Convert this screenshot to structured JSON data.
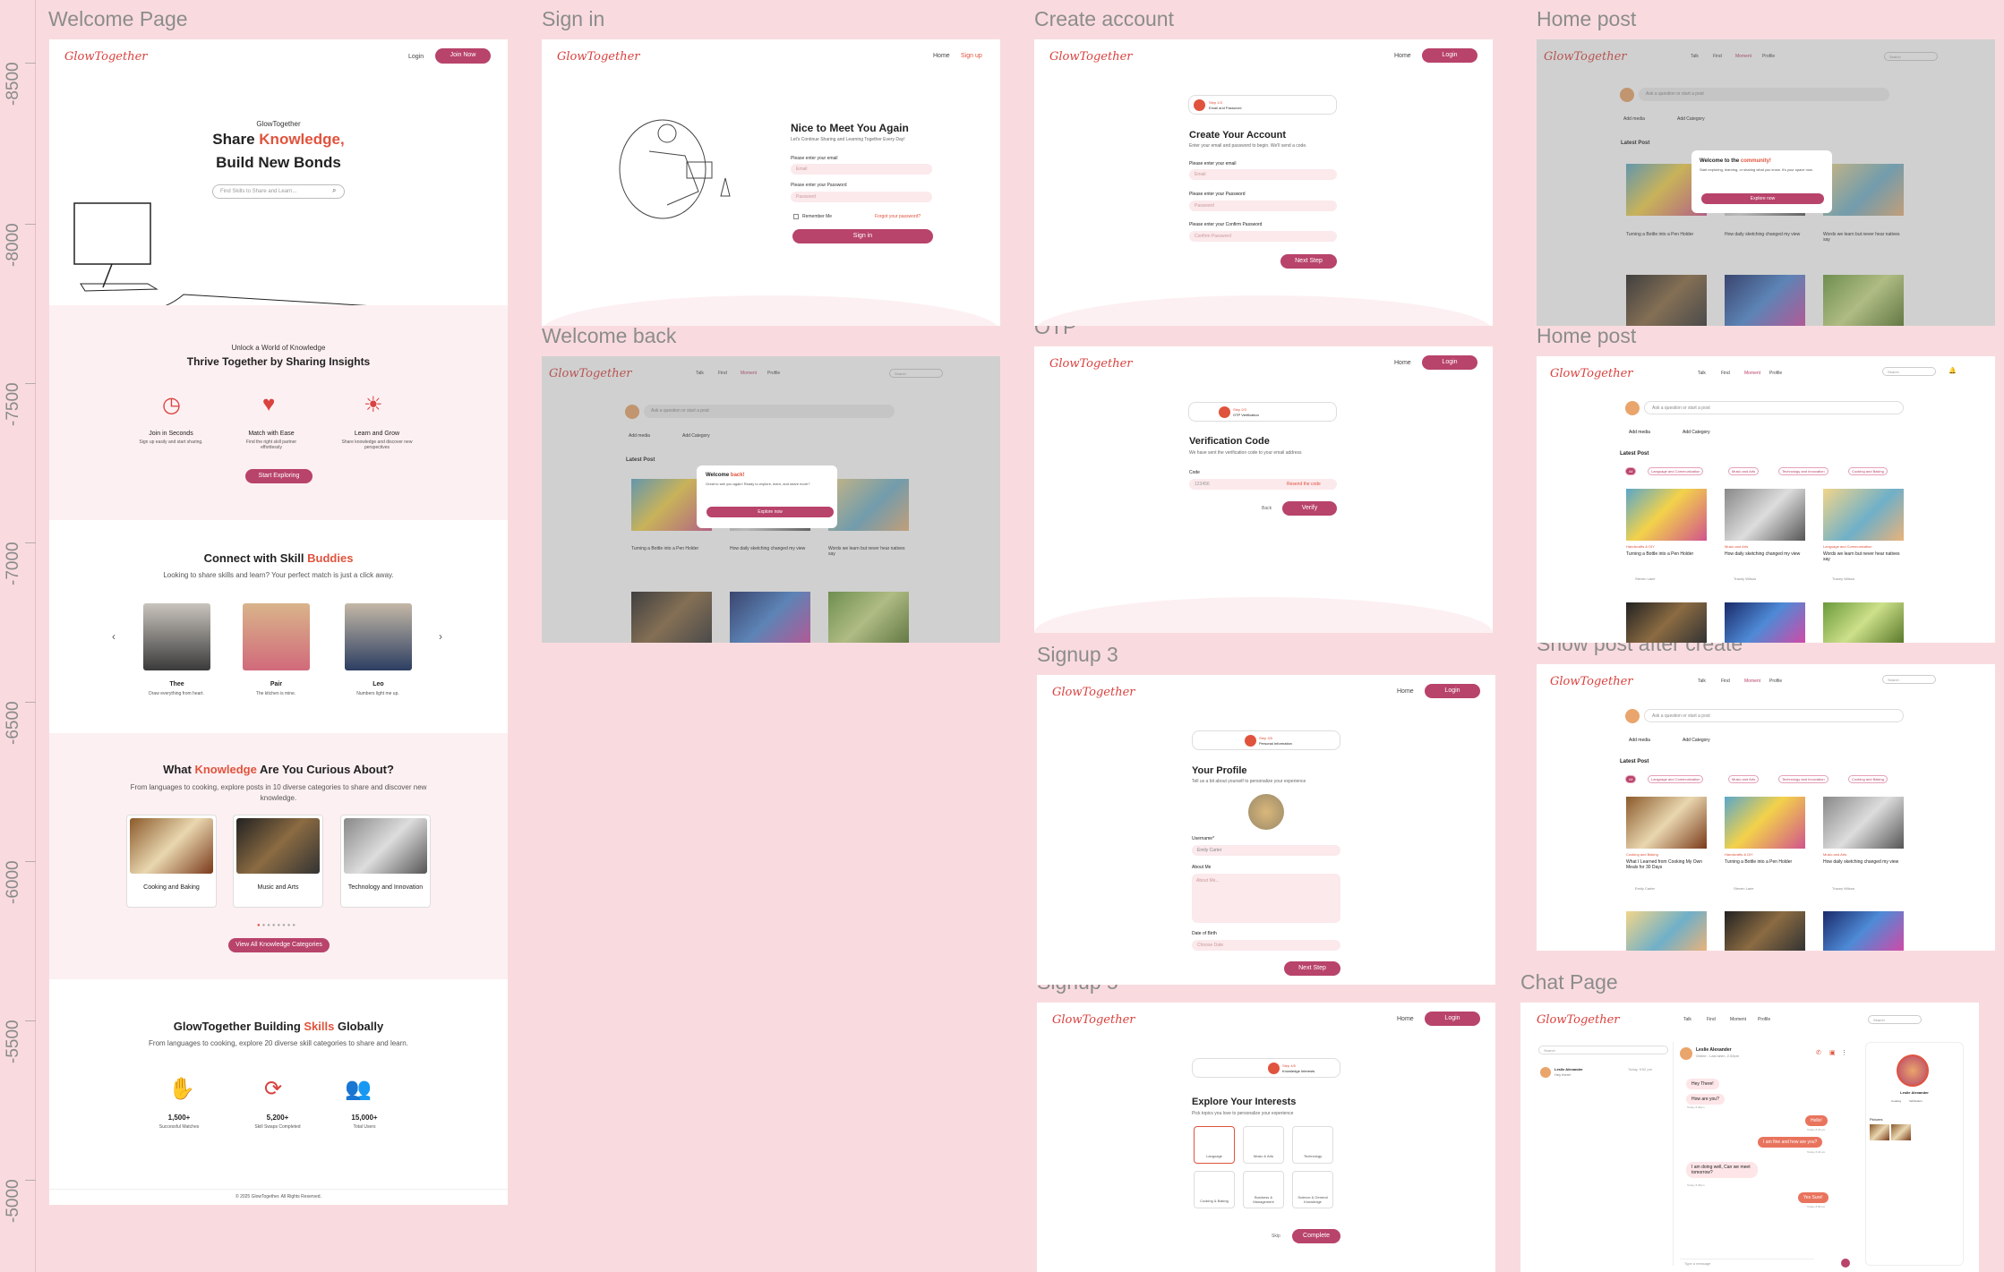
{
  "ruler": [
    "-8500",
    "-8000",
    "-7500",
    "-7000",
    "-6500",
    "-6000",
    "-5500",
    "-5000"
  ],
  "frames": {
    "welcome": "Welcome Page",
    "signin": "Sign in",
    "create": "Create account",
    "homepost1": "Home post",
    "welcomeback": "Welcome back",
    "otp": "OTP",
    "homepost2": "Home post",
    "signup3": "Signup 3",
    "showpost": "Show post after create",
    "signup5": "Signup 5",
    "chat": "Chat Page"
  },
  "brand": "GlowTogether",
  "welcome": {
    "login": "Login",
    "join": "Join Now",
    "kicker": "GlowTogether",
    "h1a": "Share ",
    "h1b": "Knowledge,",
    "h1c": "Build New Bonds",
    "search": "Find Skills to Share and Learn...",
    "s2kicker": "Unlock a World of Knowledge",
    "s2title": "Thrive Together by Sharing Insights",
    "features": [
      {
        "t": "Join in Seconds",
        "d": "Sign up easily and start sharing."
      },
      {
        "t": "Match with Ease",
        "d": "Find the right skill partner effortlessly"
      },
      {
        "t": "Learn and Grow",
        "d": "Share knowledge and discover new perspectives"
      }
    ],
    "explore": "Start Exploring",
    "s3a": "Connect with Skill ",
    "s3b": "Buddies",
    "s3sub": "Looking to share skills and learn? Your perfect match is just a click away.",
    "people": [
      {
        "n": "Thee",
        "d": "Draw everything from heart."
      },
      {
        "n": "Pair",
        "d": "The kitchen is mine."
      },
      {
        "n": "Leo",
        "d": "Numbers light me up."
      }
    ],
    "s4a": "What ",
    "s4b": "Knowledge",
    "s4c": " Are You Curious About?",
    "s4sub": "From languages to cooking, explore posts in 10 diverse categories to share and discover new knowledge.",
    "cats": [
      "Cooking and Baking",
      "Music and Arts",
      "Technology and Innovation"
    ],
    "viewall": "View All Knowledge Categories",
    "s5a": "GlowTogether Building ",
    "s5b": "Skills",
    "s5c": " Globally",
    "s5sub": "From languages to cooking, explore 20 diverse skill categories to share and learn.",
    "stats": [
      {
        "v": "1,500+",
        "l": "Successful Matches"
      },
      {
        "v": "5,200+",
        "l": "Skill Swaps Completed"
      },
      {
        "v": "15,000+",
        "l": "Total Users"
      }
    ],
    "footer": "© 2025 GlowTogether. All Rights Reserved."
  },
  "signin": {
    "home": "Home",
    "signup": "Sign up",
    "title": "Nice to Meet You Again",
    "sub": "Let's Continue Sharing and Learning Together Every Day!",
    "emailL": "Please enter your email",
    "emailP": "Email",
    "passL": "Please enter your Password",
    "passP": "Password",
    "remember": "Remember Me",
    "forgot": "Forgot your password?",
    "btn": "Sign in"
  },
  "create": {
    "home": "Home",
    "login": "Login",
    "step": "Step 1/3",
    "stepd": "Email and Password",
    "title": "Create Your Account",
    "sub": "Enter your email and password to begin. We'll send a code.",
    "emailL": "Please enter your email",
    "emailP": "Email",
    "passL": "Please enter your Password",
    "passP": "Password",
    "confL": "Please enter your Confirm Password",
    "confP": "Confirm Password",
    "btn": "Next Step"
  },
  "feed": {
    "nav": [
      "Talk",
      "Find",
      "Moment",
      "Profile"
    ],
    "search": "Search",
    "ask": "Ask a question or start a post",
    "media": "Add media",
    "cat": "Add Category",
    "latest": "Latest Post",
    "posts": [
      {
        "c": "Handicrafts & DIY",
        "t": "Turning a Bottle into a Pen Holder",
        "a": "Steven Lane"
      },
      {
        "c": "Music and Arts",
        "t": "How daily sketching changed my view",
        "a": "Tracey Wilson"
      },
      {
        "c": "Language and Communication",
        "t": "Words we learn but never hear natives say",
        "a": "Tracey Wilson"
      }
    ],
    "showposts": [
      {
        "c": "Cooking and Baking",
        "t": "What I Learned from Cooking My Own Meals for 30 Days",
        "a": "Emily Carter"
      },
      {
        "c": "Handicrafts & DIY",
        "t": "Turning a Bottle into a Pen Holder",
        "a": "Steven Lane"
      },
      {
        "c": "Music and Arts",
        "t": "How daily sketching changed my view",
        "a": "Tracey Wilson"
      }
    ],
    "chips": [
      "All",
      "Language and Communication",
      "Music and Arts",
      "Technology and Innovation",
      "Cooking and Baking"
    ]
  },
  "welcomeModal": {
    "a": "Welcome ",
    "b": "back!",
    "sub": "Great to see you again! Ready to explore, learn, and share more?",
    "btn": "Explore now"
  },
  "communityModal": {
    "a": "Welcome to the ",
    "b": "community!",
    "sub": "Start exploring, learning, or sharing what you know. It's your space now.",
    "btn": "Explore now"
  },
  "otp": {
    "home": "Home",
    "login": "Login",
    "step": "Step 2/3",
    "stepd": "OTP Verification",
    "title": "Verification Code",
    "sub": "We have sent the verification code to your email address",
    "codeL": "Code",
    "code": "123456",
    "resend": "Resend the code",
    "back": "Back",
    "btn": "Verify"
  },
  "signup3": {
    "home": "Home",
    "login": "Login",
    "step": "Step 3/5",
    "stepd": "Personal Information",
    "title": "Your Profile",
    "sub": "Tell us a bit about yourself to personalize your experience",
    "userL": "Username*",
    "user": "Emily Carter",
    "aboutL": "About Me",
    "aboutP": "About Me...",
    "dobL": "Date of Birth",
    "dobP": "Choose Date",
    "btn": "Next Step"
  },
  "signup5": {
    "home": "Home",
    "login": "Login",
    "step": "Step 4/5",
    "stepd": "Knowledge Interests",
    "title": "Explore Your Interests",
    "sub": "Pick topics you love to personalize your experience",
    "ints": [
      "Language",
      "Music & Arts",
      "Technology",
      "Cooking & Baking",
      "Business & Management",
      "Science & General Knowledge"
    ],
    "skip": "Skip",
    "btn": "Complete"
  },
  "chat": {
    "nav": [
      "Talk",
      "Find",
      "Moment",
      "Profile"
    ],
    "search": "Search",
    "listname": "Leslie Alexander",
    "listmsg": "Hey there!",
    "listtime": "Today, 9:52 pm",
    "chatname": "Leslie Alexander",
    "chatstatus": "Online - Last seen, 2.02pm",
    "msgs": [
      {
        "s": "in",
        "t": "Hey There!",
        "tm": "Today, 8.30pm"
      },
      {
        "s": "in",
        "t": "How are you?",
        "tm": "Today, 8.30pm"
      },
      {
        "s": "out",
        "t": "Hello!",
        "tm": "Today, 8.33 pm"
      },
      {
        "s": "out",
        "t": "I am fine and how are you?",
        "tm": "Today, 8.34 pm"
      },
      {
        "s": "in",
        "t": "I am doing well, Can we meet tomorrow?",
        "tm": "Today, 8.36pm"
      },
      {
        "s": "out",
        "t": "Yes Sure!",
        "tm": "Today, 8.58 pm"
      }
    ],
    "type": "Type a message",
    "pname": "Leslie Alexander",
    "tags": [
      "Cooking",
      "Verification"
    ],
    "pictures": "Pictures"
  }
}
